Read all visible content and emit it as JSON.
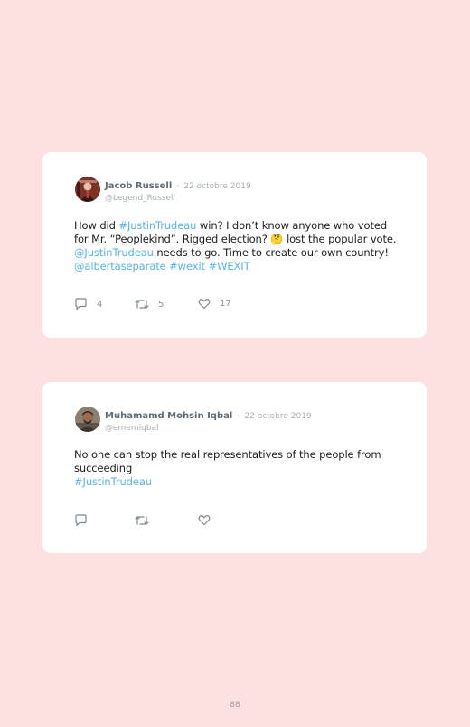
{
  "tweets": [
    {
      "author": "Jacob Russell",
      "separator": "·",
      "date": "22 octobre 2019",
      "handle": "@Legend_Russell",
      "text_parts": [
        "How did ",
        "#JustinTrudeau",
        " win? I don’t know anyone who voted for Mr. “Peoplekind”. Rigged election? ",
        "🤔",
        " lost the popular vote. ",
        "@JustinTrudeau",
        " needs to go. Time to create our own country! ",
        "@albertaseparate",
        " ",
        "#wexit",
        " ",
        "#WEXIT"
      ],
      "replies": "4",
      "retweets": "5",
      "likes": "17"
    },
    {
      "author": "Muhamamd Mohsin Iqbal",
      "separator": "·",
      "date": "22 octobre 2019",
      "handle": "@ememiqbal",
      "text_parts": [
        "No one can stop the real representatives of the people from succeeding",
        "#JustinTrudeau"
      ]
    }
  ],
  "icons": {
    "reply": "reply-icon",
    "retweet": "retweet-icon",
    "like": "heart-icon"
  },
  "colors": {
    "background": "#fde0e0",
    "card": "#ffffff",
    "link": "#56b3e6",
    "author": "#5f6b78",
    "muted": "#a9b0b8"
  },
  "page_number": "88"
}
